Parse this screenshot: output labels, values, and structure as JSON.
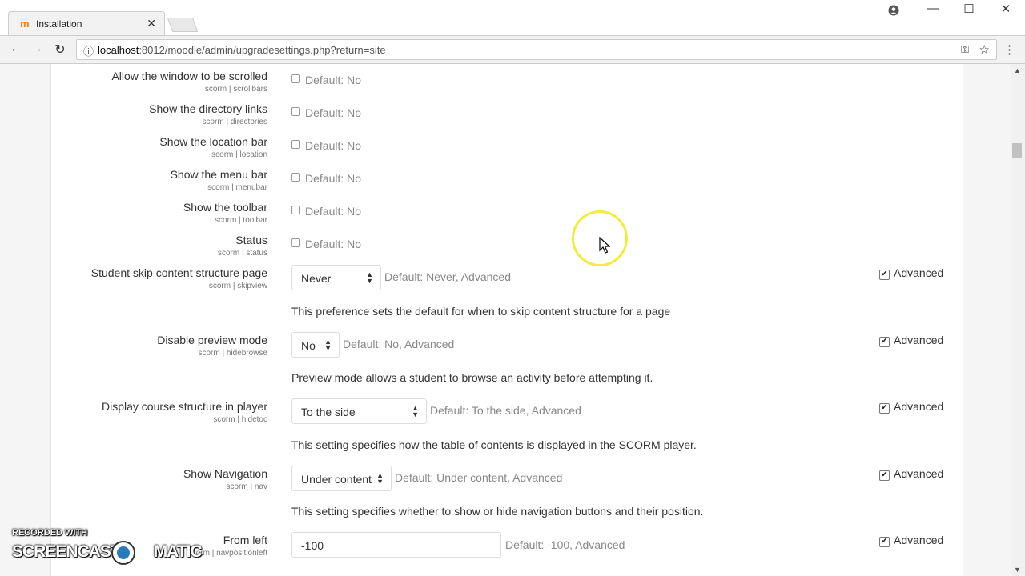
{
  "browser": {
    "tab_title": "Installation",
    "tab_favicon": "m",
    "url_host": "localhost",
    "url_rest": ":8012/moodle/admin/upgradesettings.php?return=site"
  },
  "settings": [
    {
      "label": "Allow the window to be scrolled",
      "sub": "scorm | scrollbars",
      "default": "Default: No"
    },
    {
      "label": "Show the directory links",
      "sub": "scorm | directories",
      "default": "Default: No"
    },
    {
      "label": "Show the location bar",
      "sub": "scorm | location",
      "default": "Default: No"
    },
    {
      "label": "Show the menu bar",
      "sub": "scorm | menubar",
      "default": "Default: No"
    },
    {
      "label": "Show the toolbar",
      "sub": "scorm | toolbar",
      "default": "Default: No"
    },
    {
      "label": "Status",
      "sub": "scorm | status",
      "default": "Default: No"
    },
    {
      "label": "Student skip content structure page",
      "sub": "scorm | skipview",
      "value": "Never",
      "default": "Default: Never, Advanced",
      "desc": "This preference sets the default for when to skip content structure for a page",
      "advanced": "Advanced"
    },
    {
      "label": "Disable preview mode",
      "sub": "scorm | hidebrowse",
      "value": "No",
      "default": "Default: No, Advanced",
      "desc": "Preview mode allows a student to browse an activity before attempting it.",
      "advanced": "Advanced"
    },
    {
      "label": "Display course structure in player",
      "sub": "scorm | hidetoc",
      "value": "To the side",
      "default": "Default: To the side, Advanced",
      "desc": "This setting specifies how the table of contents is displayed in the SCORM player.",
      "advanced": "Advanced"
    },
    {
      "label": "Show Navigation",
      "sub": "scorm | nav",
      "value": "Under content",
      "default": "Default: Under content, Advanced",
      "desc": "This setting specifies whether to show or hide navigation buttons and their position.",
      "advanced": "Advanced"
    },
    {
      "label": "From left",
      "sub": "scorm | navpositionleft",
      "value": "-100",
      "default": "Default: -100, Advanced",
      "advanced": "Advanced"
    }
  ],
  "watermark": {
    "line1": "RECORDED WITH",
    "brand_left": "SCREENCAST",
    "brand_right": "MATIC"
  }
}
